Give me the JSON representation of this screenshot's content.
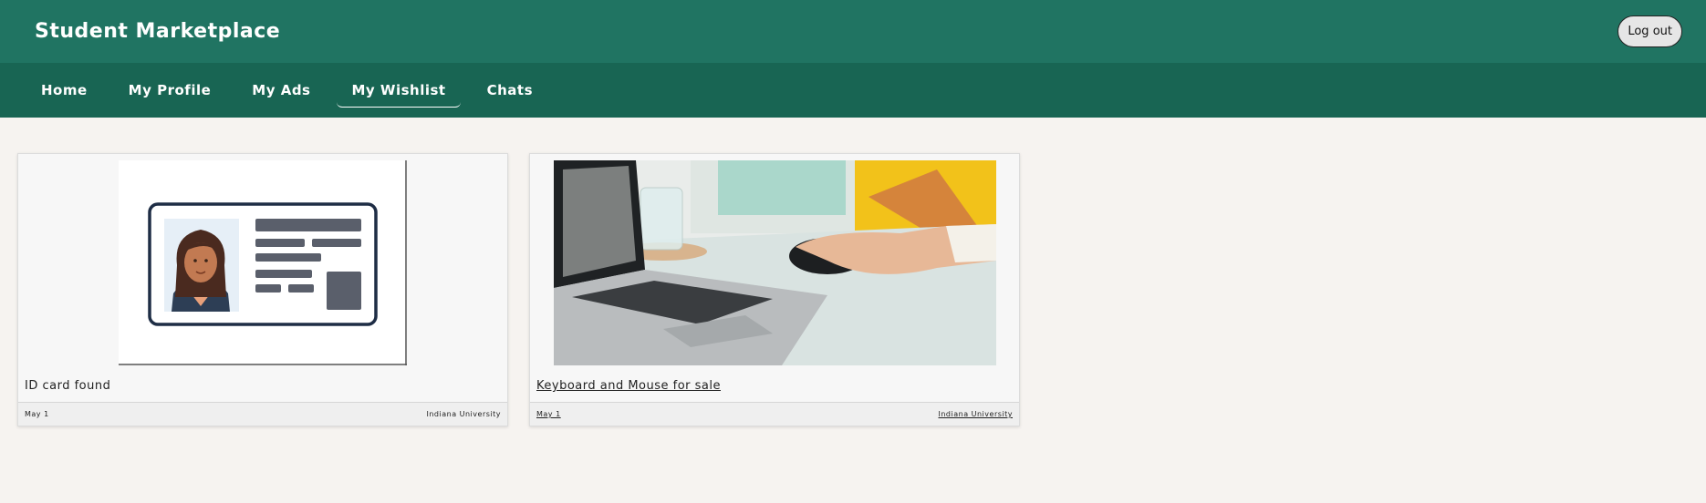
{
  "header": {
    "title": "Student Marketplace",
    "logout_label": "Log out"
  },
  "nav": {
    "items": [
      {
        "label": "Home"
      },
      {
        "label": "My Profile"
      },
      {
        "label": "My Ads"
      },
      {
        "label": "My Wishlist",
        "active": true
      },
      {
        "label": "Chats"
      }
    ]
  },
  "listings": [
    {
      "title": "ID card found",
      "date": "May 1",
      "location": "Indiana University",
      "image": "id-card-illustration"
    },
    {
      "title": "Keyboard and Mouse for sale",
      "date": "May 1",
      "location": "Indiana University",
      "image": "laptop-mouse-photo"
    }
  ],
  "colors": {
    "header": "#207462",
    "nav": "#186553",
    "background": "#f6f3f0"
  }
}
